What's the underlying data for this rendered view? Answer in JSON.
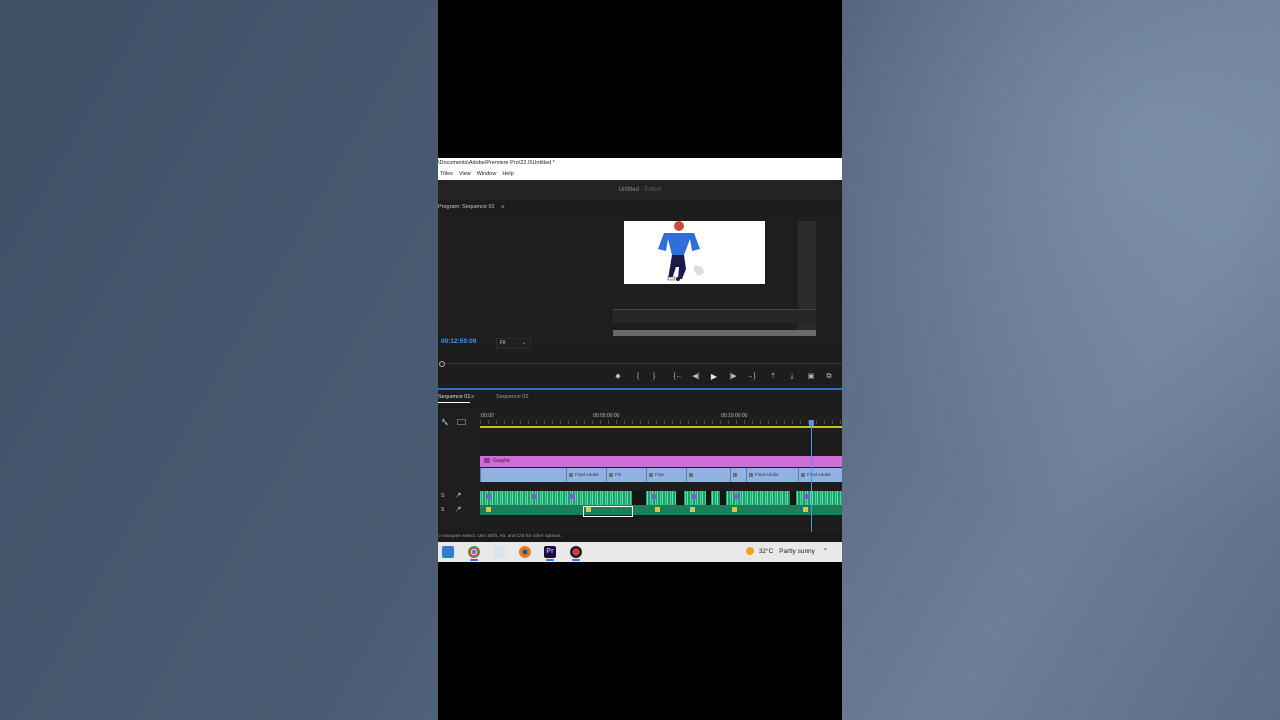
{
  "window": {
    "title_path": "\\Documents\\Adobe\\Premiere Pro\\22.0\\Untitled *",
    "menu": [
      "Titles",
      "View",
      "Window",
      "Help"
    ],
    "doc_title": "Untitled",
    "doc_status": "- Edited"
  },
  "program_monitor": {
    "panel_title": "Program: Sequence 01",
    "menu_icon": "≡",
    "timecode": "00:12:59:09",
    "fit_label": "Fit"
  },
  "transport": {
    "icons": [
      "marker-icon",
      "in-point-icon",
      "out-point-icon",
      "go-to-in-icon",
      "step-back-icon",
      "play-icon",
      "step-forward-icon",
      "go-to-out-icon",
      "lift-icon",
      "extract-icon",
      "export-frame-icon",
      "comparison-view-icon"
    ],
    "glyphs": [
      "◆",
      "{",
      "}",
      "{←",
      "◀|",
      "▶",
      "|▶",
      "→}",
      "⤒",
      "⤓",
      "▣",
      "⧉"
    ]
  },
  "timeline": {
    "tabs": [
      "Sequence 01",
      "Sequence 02"
    ],
    "ruler_labels": [
      ":00:00",
      "00:05:00:00",
      "00:10:00:00"
    ],
    "graphic_clip_label": "Graphic",
    "video_clips": [
      "Final Adobe",
      "Fin",
      "Fina",
      "Final Adobe",
      "Final Adobe"
    ],
    "audio_track_labels": [
      "S",
      "S"
    ]
  },
  "status_bar": {
    "text": "o marquee select. Use Shift, Alt, and Ctrl for other options."
  },
  "taskbar": {
    "apps": [
      "mail-icon",
      "chrome-icon",
      "files-icon",
      "blender-icon",
      "premiere-icon",
      "davinci-icon"
    ],
    "premiere_label": "Pr",
    "temperature": "32°C",
    "weather": "Partly sunny"
  },
  "colors": {
    "timecode_blue": "#4a95e6",
    "graphic_track": "#d06ed7",
    "video_track": "#8fb2e0",
    "audio_track": "#219a6c",
    "playhead": "#4d93f0"
  }
}
